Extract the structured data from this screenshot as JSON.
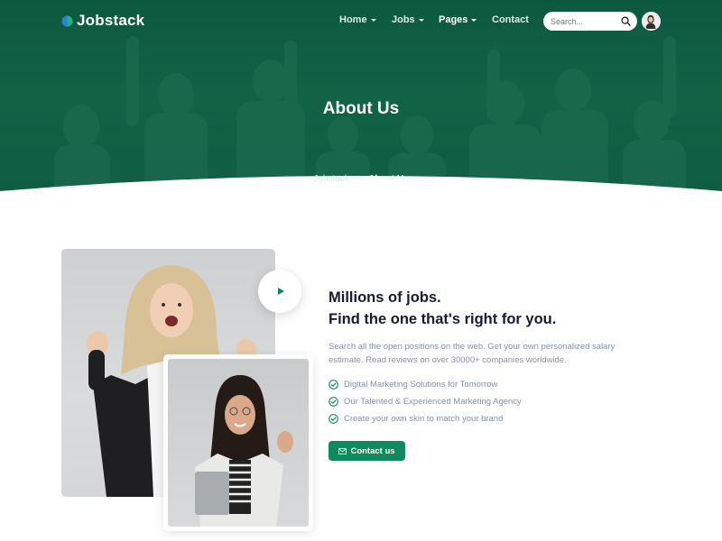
{
  "brand": {
    "name": "Jobstack",
    "accent": "#0f8a5f",
    "hero_color": "#13634a"
  },
  "nav": {
    "items": [
      {
        "label": "Home",
        "has_dropdown": true
      },
      {
        "label": "Jobs",
        "has_dropdown": true
      },
      {
        "label": "Pages",
        "has_dropdown": true,
        "active": true
      },
      {
        "label": "Contact",
        "has_dropdown": false
      }
    ],
    "search_placeholder": "Search...",
    "icons": {
      "search": "search-icon",
      "avatar": "user-avatar"
    }
  },
  "hero": {
    "title": "About Us",
    "breadcrumb": {
      "parent": "Jobstack",
      "separator": ">",
      "current": "About Us"
    }
  },
  "about": {
    "heading_line1": "Millions of jobs.",
    "heading_line2": "Find the one that's right for you.",
    "description": "Search all the open positions on the web. Get your own personalized salary estimate. Read reviews on over 30000+ companies worldwide.",
    "features": [
      "Digital Marketing Solutions for Tomorrow",
      "Our Talented & Experienced Marketing Agency",
      "Create your own skin to match your brand"
    ],
    "cta_label": "Contact us",
    "icons": {
      "play": "play-icon",
      "check": "check-circle-icon",
      "mail": "mail-icon"
    }
  }
}
